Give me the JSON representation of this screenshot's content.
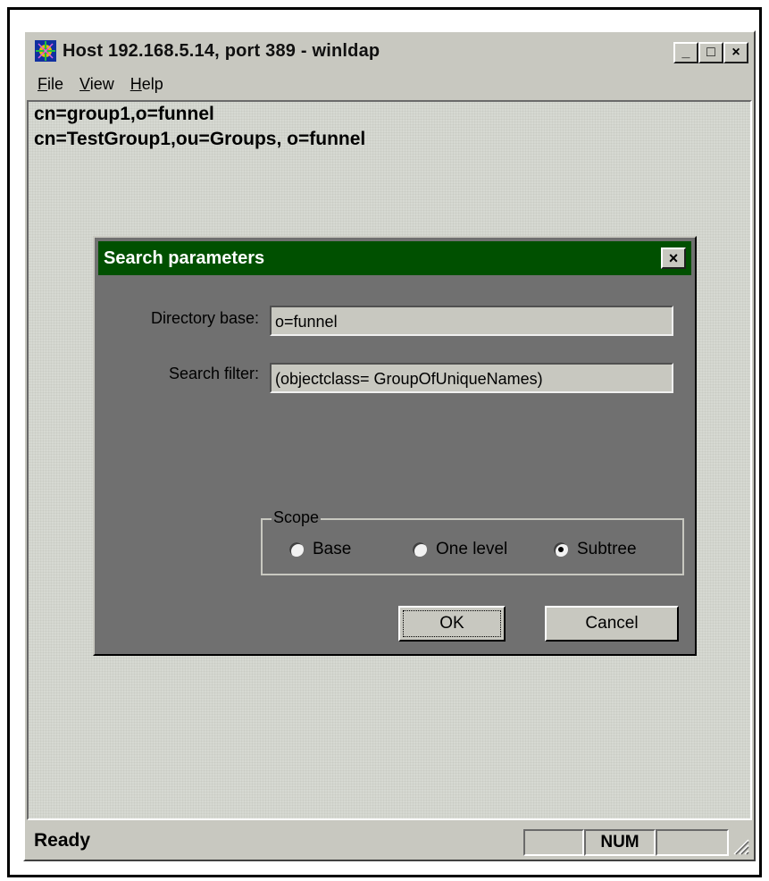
{
  "window": {
    "title": "Host 192.168.5.14, port 389 - winldap",
    "minimize_glyph": "_",
    "maximize_glyph": "□",
    "close_glyph": "×"
  },
  "menu": {
    "items": [
      {
        "label": "File",
        "accel": "F",
        "rest": "ile"
      },
      {
        "label": "View",
        "accel": "V",
        "rest": "iew"
      },
      {
        "label": "Help",
        "accel": "H",
        "rest": "elp"
      }
    ]
  },
  "results": {
    "lines": [
      "cn=group1,o=funnel",
      "cn=TestGroup1,ou=Groups, o=funnel"
    ]
  },
  "dialog": {
    "title": "Search parameters",
    "close_glyph": "×",
    "directory_base_label": "Directory base:",
    "directory_base_value": "o=funnel",
    "search_filter_label": "Search filter:",
    "search_filter_value": "(objectclass= GroupOfUniqueNames)",
    "scope": {
      "legend": "Scope",
      "options": [
        {
          "label": "Base",
          "selected": false
        },
        {
          "label": "One level",
          "selected": false
        },
        {
          "label": "Subtree",
          "selected": true
        }
      ]
    },
    "ok_label": "OK",
    "cancel_label": "Cancel"
  },
  "statusbar": {
    "text": "Ready",
    "panels": [
      "",
      "NUM",
      ""
    ]
  },
  "colors": {
    "dialog_title_bg": "#005000",
    "window_bg": "#c8c8c0",
    "dialog_bg": "#707070"
  },
  "icons": {
    "app": "winldap-app-icon",
    "resize": "resize-grip-icon"
  }
}
